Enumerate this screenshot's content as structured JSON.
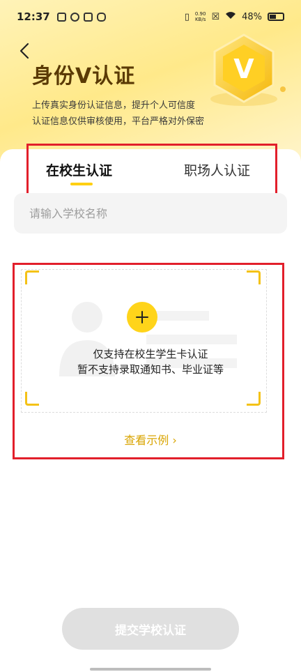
{
  "status_bar": {
    "time": "12:37",
    "net_speed_value": "0.90",
    "net_speed_unit": "KB/s",
    "battery": "48%"
  },
  "header": {
    "title": "身份V认证",
    "subtitle_line1": "上传真实身份认证信息，提升个人可信度",
    "subtitle_line2": "认证信息仅供审核使用，平台严格对外保密",
    "badge_letter": "V"
  },
  "tabs": [
    {
      "label": "在校生认证",
      "active": true
    },
    {
      "label": "职场人认证",
      "active": false
    }
  ],
  "school_input": {
    "value": "",
    "placeholder": "请输入学校名称"
  },
  "upload": {
    "plus_icon": "plus-icon",
    "hint_line1": "仅支持在校生学生卡认证",
    "hint_line2": "暂不支持录取通知书、毕业证等",
    "view_example": "查看示例 ›"
  },
  "submit_label": "提交学校认证",
  "colors": {
    "accent_yellow": "#ffd41a",
    "annotation_red": "#e21f2b",
    "link_gold": "#d9a400",
    "disabled_button": "#e0e0e0"
  }
}
